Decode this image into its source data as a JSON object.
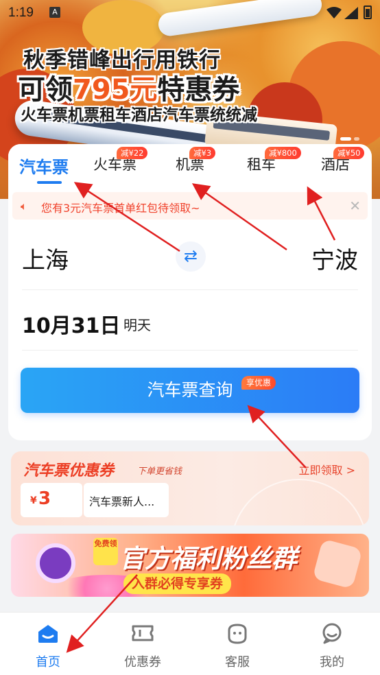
{
  "status_bar": {
    "time": "1:19",
    "notification_icon": "A"
  },
  "hero": {
    "line1": "秋季错峰出行用铁行",
    "line2_prefix": "可领",
    "line2_highlight": "795元",
    "line2_suffix": "特惠券",
    "line3": "火车票机票租车酒店汽车票统统减"
  },
  "tabs": [
    {
      "label": "汽车票",
      "active": true,
      "badge": ""
    },
    {
      "label": "火车票",
      "active": false,
      "badge": "减¥22"
    },
    {
      "label": "机票",
      "active": false,
      "badge": "减¥3"
    },
    {
      "label": "租车",
      "active": false,
      "badge": "减¥800"
    },
    {
      "label": "酒店",
      "active": false,
      "badge": "减¥50"
    }
  ],
  "notice": {
    "text": "您有3元汽车票首单红包待领取~",
    "close": "✕"
  },
  "route": {
    "from": "上海",
    "to": "宁波"
  },
  "date": {
    "value": "10月31日",
    "label": "明天"
  },
  "search": {
    "label": "汽车票查询",
    "badge": "享优惠"
  },
  "coupon": {
    "title": "汽车票优惠券",
    "subtitle": "下单更省钱",
    "link": "立即领取 >",
    "currency": "¥",
    "amount": "3",
    "name": "汽车票新人..."
  },
  "fan_banner": {
    "free_tag": "免费领",
    "title": "官方福利粉丝群",
    "subtitle": "入群必得专享券"
  },
  "nav": [
    {
      "label": "首页",
      "icon": "home-icon",
      "active": true
    },
    {
      "label": "优惠券",
      "icon": "ticket-icon",
      "active": false
    },
    {
      "label": "客服",
      "icon": "customer-service-icon",
      "active": false
    },
    {
      "label": "我的",
      "icon": "profile-icon",
      "active": false
    }
  ],
  "colors": {
    "accent": "#1e7cf0",
    "highlight": "#f1581d",
    "notice_text": "#f0432d",
    "annotation_arrow": "#e02020"
  }
}
